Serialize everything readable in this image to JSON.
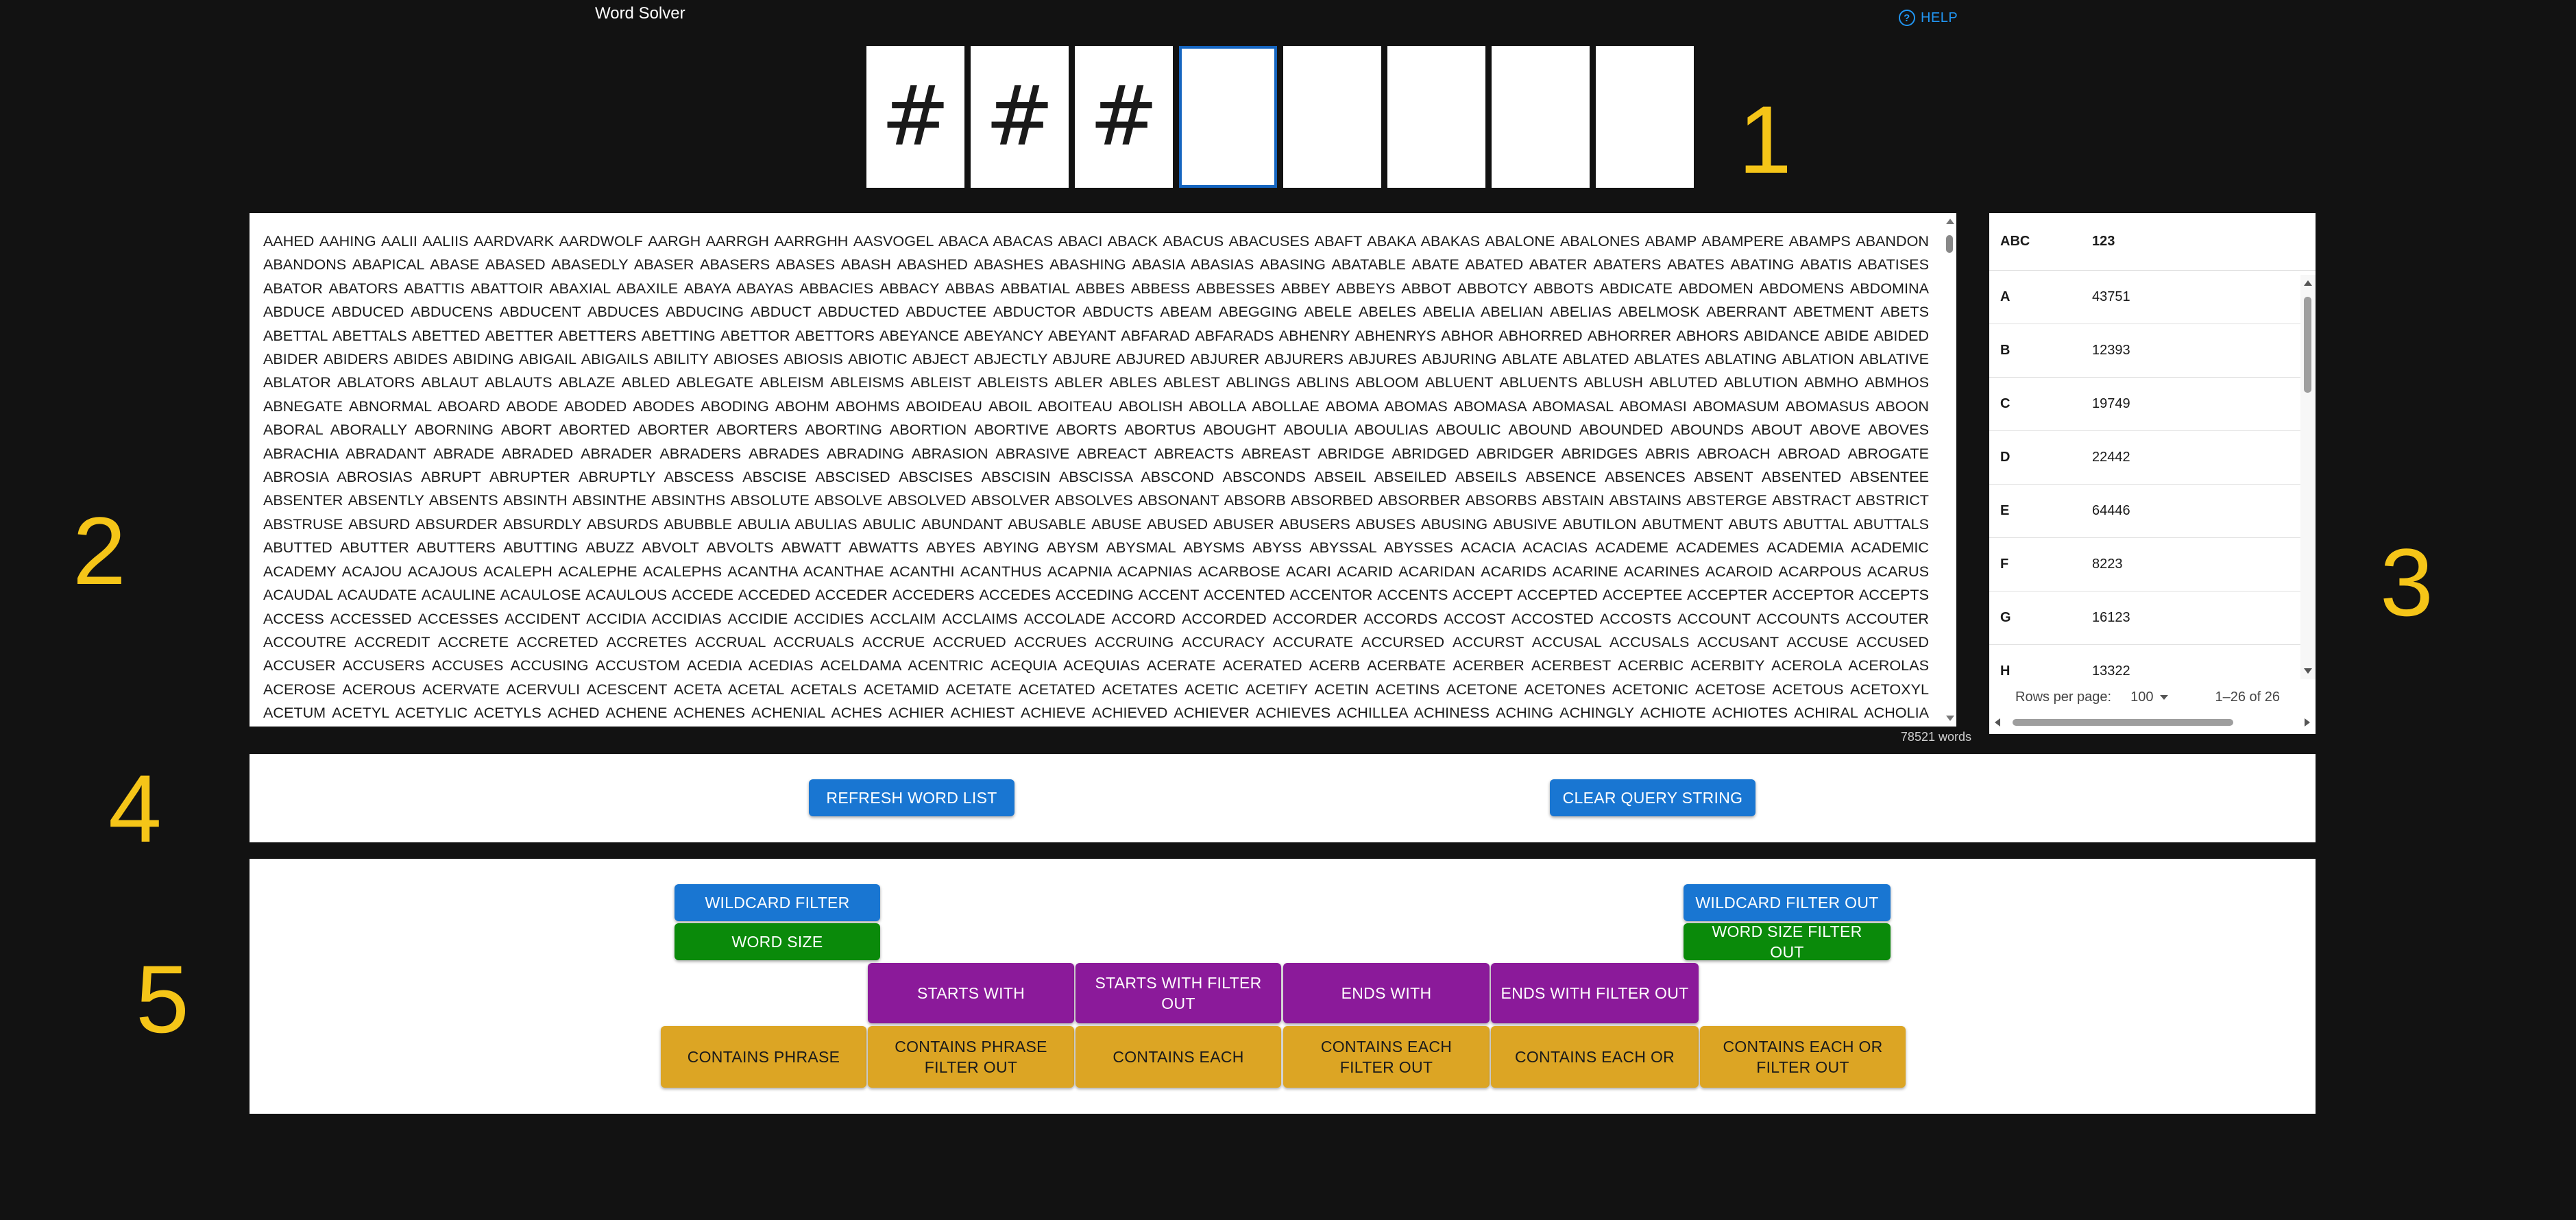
{
  "app_title": "Word Solver",
  "help_label": "HELP",
  "tiles": [
    "#",
    "#",
    "#",
    "",
    "",
    "",
    "",
    ""
  ],
  "section_numbers": [
    "1",
    "2",
    "3",
    "4",
    "5"
  ],
  "wordlist": {
    "text": "AAHED AAHING AALII AALIIS AARDVARK AARDWOLF AARGH AARRGH AARRGHH AASVOGEL ABACA ABACAS ABACI ABACK ABACUS ABACUSES ABAFT ABAKA ABAKAS ABALONE ABALONES ABAMP ABAMPERE ABAMPS ABANDON ABANDONS ABAPICAL ABASE ABASED ABASEDLY ABASER ABASERS ABASES ABASH ABASHED ABASHES ABASHING ABASIA ABASIAS ABASING ABATABLE ABATE ABATED ABATER ABATERS ABATES ABATING ABATIS ABATISES ABATOR ABATORS ABATTIS ABATTOIR ABAXIAL ABAXILE ABAYA ABAYAS ABBACIES ABBACY ABBAS ABBATIAL ABBES ABBESS ABBESSES ABBEY ABBEYS ABBOT ABBOTCY ABBOTS ABDICATE ABDOMEN ABDOMENS ABDOMINA ABDUCE ABDUCED ABDUCENS ABDUCENT ABDUCES ABDUCING ABDUCT ABDUCTED ABDUCTEE ABDUCTOR ABDUCTS ABEAM ABEGGING ABELE ABELES ABELIA ABELIAN ABELIAS ABELMOSK ABERRANT ABETMENT ABETS ABETTAL ABETTALS ABETTED ABETTER ABETTERS ABETTING ABETTOR ABETTORS ABEYANCE ABEYANCY ABEYANT ABFARAD ABFARADS ABHENRY ABHENRYS ABHOR ABHORRED ABHORRER ABHORS ABIDANCE ABIDE ABIDED ABIDER ABIDERS ABIDES ABIDING ABIGAIL ABIGAILS ABILITY ABIOSES ABIOSIS ABIOTIC ABJECT ABJECTLY ABJURE ABJURED ABJURER ABJURERS ABJURES ABJURING ABLATE ABLATED ABLATES ABLATING ABLATION ABLATIVE ABLATOR ABLATORS ABLAUT ABLAUTS ABLAZE ABLED ABLEGATE ABLEISM ABLEISMS ABLEIST ABLEISTS ABLER ABLES ABLEST ABLINGS ABLINS ABLOOM ABLUENT ABLUENTS ABLUSH ABLUTED ABLUTION ABMHO ABMHOS ABNEGATE ABNORMAL ABOARD ABODE ABODED ABODES ABODING ABOHM ABOHMS ABOIDEAU ABOIL ABOITEAU ABOLISH ABOLLA ABOLLAE ABOMA ABOMAS ABOMASA ABOMASAL ABOMASI ABOMASUM ABOMASUS ABOON ABORAL ABORALLY ABORNING ABORT ABORTED ABORTER ABORTERS ABORTING ABORTION ABORTIVE ABORTS ABORTUS ABOUGHT ABOULIA ABOULIAS ABOULIC ABOUND ABOUNDED ABOUNDS ABOUT ABOVE ABOVES ABRACHIA ABRADANT ABRADE ABRADED ABRADER ABRADERS ABRADES ABRADING ABRASION ABRASIVE ABREACT ABREACTS ABREAST ABRIDGE ABRIDGED ABRIDGER ABRIDGES ABRIS ABROACH ABROAD ABROGATE ABROSIA ABROSIAS ABRUPT ABRUPTER ABRUPTLY ABSCESS ABSCISE ABSCISED ABSCISES ABSCISIN ABSCISSA ABSCOND ABSCONDS ABSEIL ABSEILED ABSEILS ABSENCE ABSENCES ABSENT ABSENTED ABSENTEE ABSENTER ABSENTLY ABSENTS ABSINTH ABSINTHE ABSINTHS ABSOLUTE ABSOLVE ABSOLVED ABSOLVER ABSOLVES ABSONANT ABSORB ABSORBED ABSORBER ABSORBS ABSTAIN ABSTAINS ABSTERGE ABSTRACT ABSTRICT ABSTRUSE ABSURD ABSURDER ABSURDLY ABSURDS ABUBBLE ABULIA ABULIAS ABULIC ABUNDANT ABUSABLE ABUSE ABUSED ABUSER ABUSERS ABUSES ABUSING ABUSIVE ABUTILON ABUTMENT ABUTS ABUTTAL ABUTTALS ABUTTED ABUTTER ABUTTERS ABUTTING ABUZZ ABVOLT ABVOLTS ABWATT ABWATTS ABYES ABYING ABYSM ABYSMAL ABYSMS ABYSS ABYSSAL ABYSSES ACACIA ACACIAS ACADEME ACADEMES ACADEMIA ACADEMIC ACADEMY ACAJOU ACAJOUS ACALEPH ACALEPHE ACALEPHS ACANTHA ACANTHAE ACANTHI ACANTHUS ACAPNIA ACAPNIAS ACARBOSE ACARI ACARID ACARIDAN ACARIDS ACARINE ACARINES ACAROID ACARPOUS ACARUS ACAUDAL ACAUDATE ACAULINE ACAULOSE ACAULOUS ACCEDE ACCEDED ACCEDER ACCEDERS ACCEDES ACCEDING ACCENT ACCENTED ACCENTOR ACCENTS ACCEPT ACCEPTED ACCEPTEE ACCEPTER ACCEPTOR ACCEPTS ACCESS ACCESSED ACCESSES ACCIDENT ACCIDIA ACCIDIAS ACCIDIE ACCIDIES ACCLAIM ACCLAIMS ACCOLADE ACCORD ACCORDED ACCORDER ACCORDS ACCOST ACCOSTED ACCOSTS ACCOUNT ACCOUNTS ACCOUTER ACCOUTRE ACCREDIT ACCRETE ACCRETED ACCRETES ACCRUAL ACCRUALS ACCRUE ACCRUED ACCRUES ACCRUING ACCURACY ACCURATE ACCURSED ACCURST ACCUSAL ACCUSALS ACCUSANT ACCUSE ACCUSED ACCUSER ACCUSERS ACCUSES ACCUSING ACCUSTOM ACEDIA ACEDIAS ACELDAMA ACENTRIC ACEQUIA ACEQUIAS ACERATE ACERATED ACERB ACERBATE ACERBER ACERBEST ACERBIC ACERBITY ACEROLA ACEROLAS ACEROSE ACEROUS ACERVATE ACERVULI ACESCENT ACETA ACETAL ACETALS ACETAMID ACETATE ACETATED ACETATES ACETIC ACETIFY ACETIN ACETINS ACETONE ACETONES ACETONIC ACETOSE ACETOUS ACETOXYL ACETUM ACETYL ACETYLIC ACETYLS ACHED ACHENE ACHENES ACHENIAL ACHES ACHIER ACHIEST ACHIEVE ACHIEVED ACHIEVER ACHIEVES ACHILLEA ACHINESS ACHING ACHINGLY ACHIOTE ACHIOTES ACHIRAL ACHOLIA ACHOLIAS ACHOO ACHROMAT ACHROMIC ACICULA ACICULAE ACICULAR ACICULAS",
    "count_label": "78521 words"
  },
  "letter_table": {
    "headers": [
      "ABC",
      "123"
    ],
    "rows": [
      {
        "letter": "A",
        "count": "43751"
      },
      {
        "letter": "B",
        "count": "12393"
      },
      {
        "letter": "C",
        "count": "19749"
      },
      {
        "letter": "D",
        "count": "22442"
      },
      {
        "letter": "E",
        "count": "64446"
      },
      {
        "letter": "F",
        "count": "8223"
      },
      {
        "letter": "G",
        "count": "16123"
      },
      {
        "letter": "H",
        "count": "13322"
      }
    ],
    "rows_per_page_label": "Rows per page:",
    "rows_per_page_value": "100",
    "range_label": "1–26 of 26"
  },
  "actions": {
    "refresh": "REFRESH WORD LIST",
    "clear": "CLEAR QUERY STRING"
  },
  "filters": {
    "wildcard": "WILDCARD FILTER",
    "word_size": "WORD SIZE",
    "wildcard_out": "WILDCARD FILTER OUT",
    "word_size_out": "WORD SIZE FILTER OUT",
    "starts_with": "STARTS WITH",
    "starts_with_out": "STARTS WITH FILTER OUT",
    "ends_with": "ENDS WITH",
    "ends_with_out": "ENDS WITH FILTER OUT",
    "contains_phrase": "CONTAINS PHRASE",
    "contains_phrase_out": "CONTAINS PHRASE FILTER OUT",
    "contains_each": "CONTAINS EACH",
    "contains_each_out": "CONTAINS EACH FILTER OUT",
    "contains_each_or": "CONTAINS EACH OR",
    "contains_each_or_out": "CONTAINS EACH OR FILTER OUT"
  },
  "colors": {
    "background": "#121212",
    "blue": "#1976d2",
    "green": "#0a8a0a",
    "purple": "#8b1a9a",
    "gold": "#dca524",
    "section_number": "#f5c518",
    "help": "#2196f3"
  }
}
